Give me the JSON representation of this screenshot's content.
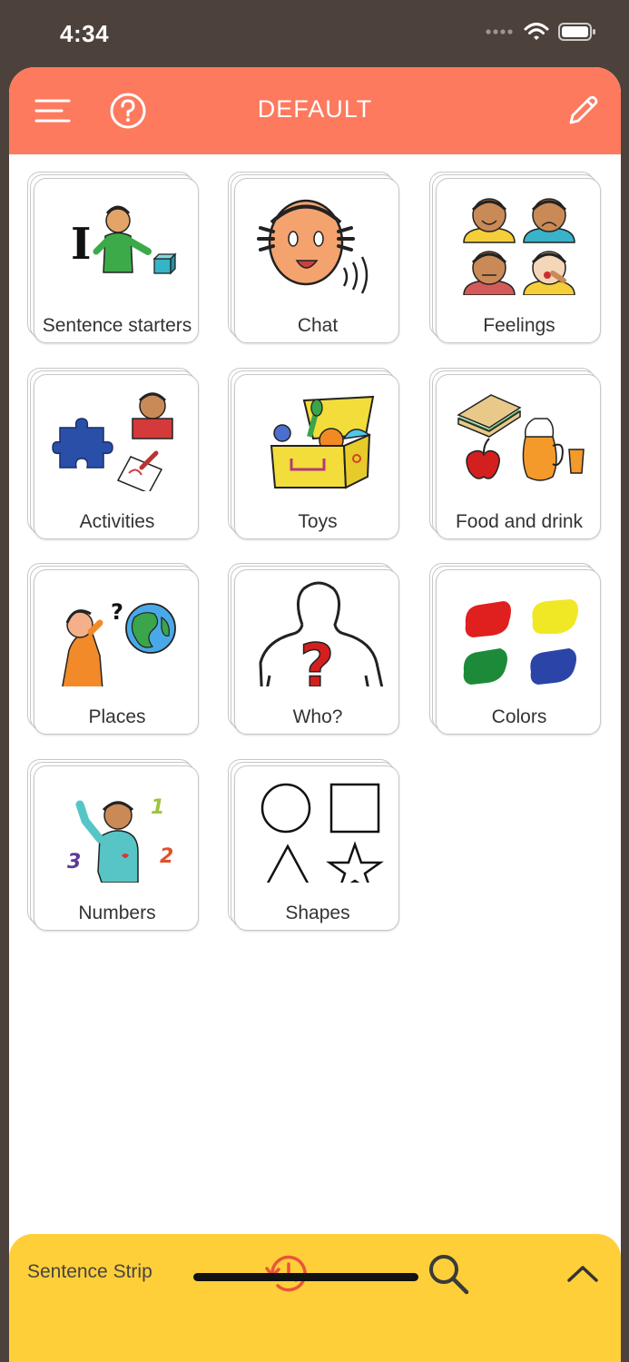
{
  "status": {
    "time": "4:34"
  },
  "header": {
    "title": "DEFAULT"
  },
  "tiles": [
    {
      "label": "Sentence starters"
    },
    {
      "label": "Chat"
    },
    {
      "label": "Feelings"
    },
    {
      "label": "Activities"
    },
    {
      "label": "Toys"
    },
    {
      "label": "Food and drink"
    },
    {
      "label": "Places"
    },
    {
      "label": "Who?"
    },
    {
      "label": "Colors"
    },
    {
      "label": "Numbers"
    },
    {
      "label": "Shapes"
    }
  ],
  "bottom": {
    "label": "Sentence Strip"
  },
  "colors": {
    "header": "#fd7a5f",
    "bottom_bar": "#ffcf39",
    "history_icon": "#e8553c",
    "background": "#4d413c"
  }
}
